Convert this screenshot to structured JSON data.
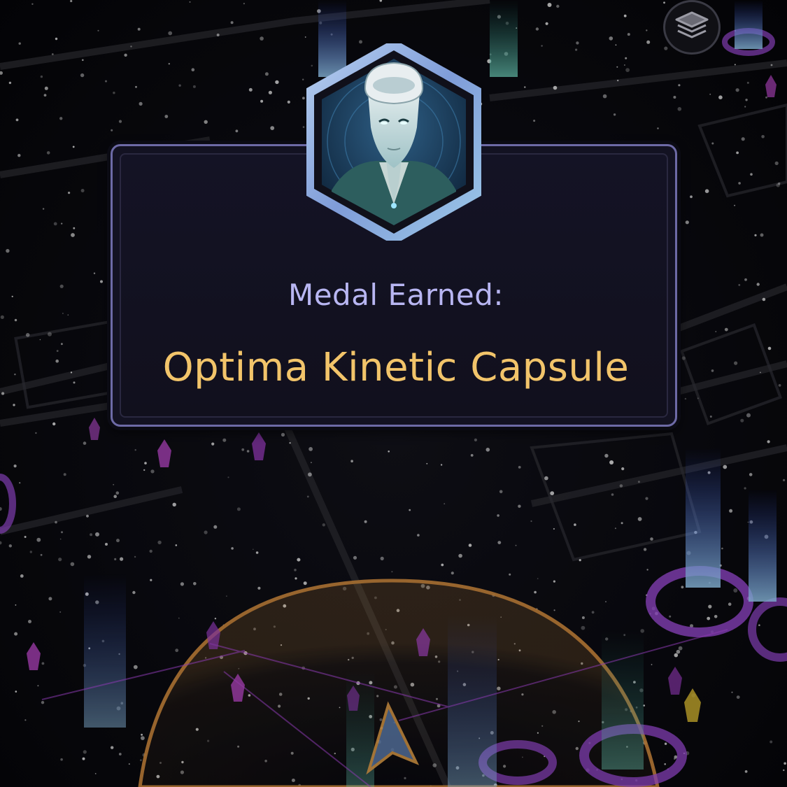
{
  "medal_popup": {
    "label": "Medal Earned:",
    "name": "Optima Kinetic Capsule",
    "badge_icon": "optima-agent-portrait-icon"
  },
  "map": {
    "layers_icon": "layers-icon"
  },
  "colors": {
    "label_color": "#b8b6f2",
    "name_color": "#f2c46a",
    "card_border": "#6d6aa6",
    "card_background": "#131222",
    "badge_frame": "#8fb4e0",
    "portal_purple": "#a24ee0",
    "portal_blue": "#4d7cff",
    "range_ring": "#e5a14a"
  }
}
